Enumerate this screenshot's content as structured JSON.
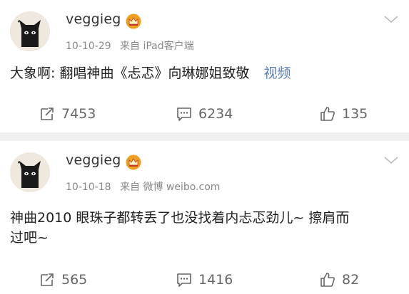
{
  "posts": [
    {
      "username": "veggieg",
      "date": "10-10-29",
      "source": "来自 iPad客户端",
      "text": "大象啊: 翻唱神曲《忐忑》向琳娜姐致敬",
      "link_text": "视频",
      "reposts": "7453",
      "comments": "6234",
      "likes": "135"
    },
    {
      "username": "veggieg",
      "date": "10-10-18",
      "source": "来自 微博 weibo.com",
      "text_line1": "神曲2010 眼珠子都转丢了也没找着内忐忑劲儿~ 擦肩而",
      "text_line2": "过吧~",
      "reposts": "565",
      "comments": "1416",
      "likes": "82"
    }
  ],
  "colors": {
    "link": "#5b7dbe",
    "separator": "#f1f1f1",
    "crown": "#f0a020"
  },
  "icons": [
    "avatar-cat",
    "crown-icon",
    "chevron-down-icon",
    "repost-icon",
    "comment-icon",
    "like-icon"
  ]
}
